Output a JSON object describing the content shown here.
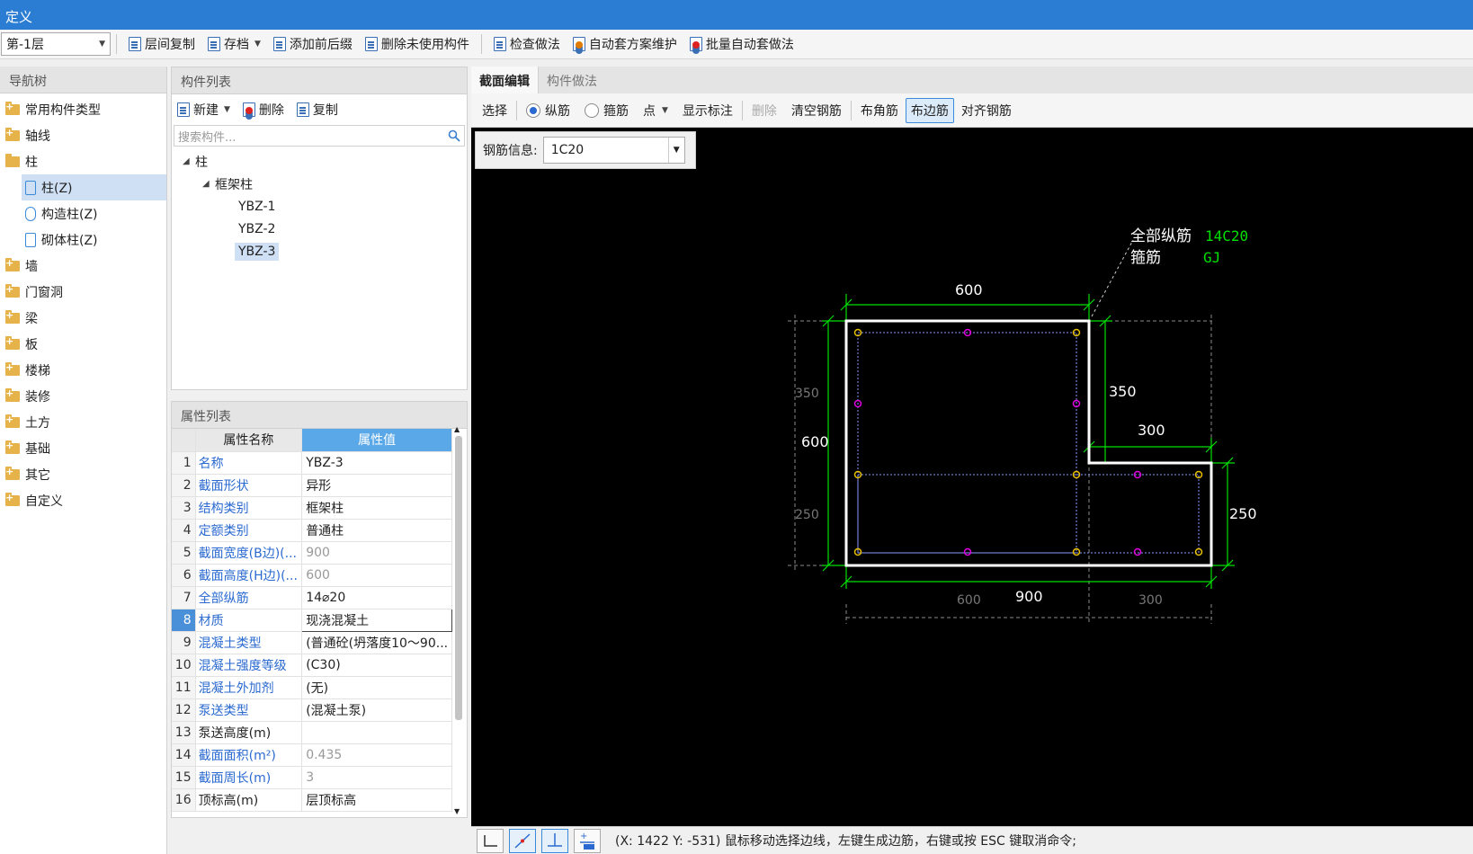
{
  "window": {
    "title": "定义"
  },
  "toolbar": {
    "floor": "第-1层",
    "buttons": [
      "层间复制",
      "存档",
      "添加前后缀",
      "删除未使用构件",
      "检查做法",
      "自动套方案维护",
      "批量自动套做法"
    ]
  },
  "nav": {
    "title": "导航树",
    "items": [
      {
        "label": "常用构件类型",
        "level": 0,
        "icon": "folder-icon"
      },
      {
        "label": "轴线",
        "level": 0,
        "icon": "folder-icon"
      },
      {
        "label": "柱",
        "level": 0,
        "icon": "folder-open-icon"
      },
      {
        "label": "柱(Z)",
        "level": 1,
        "icon": "column-icon",
        "selected": true
      },
      {
        "label": "构造柱(Z)",
        "level": 1,
        "icon": "constructional-column-icon"
      },
      {
        "label": "砌体柱(Z)",
        "level": 1,
        "icon": "masonry-column-icon"
      },
      {
        "label": "墙",
        "level": 0,
        "icon": "folder-icon"
      },
      {
        "label": "门窗洞",
        "level": 0,
        "icon": "folder-icon"
      },
      {
        "label": "梁",
        "level": 0,
        "icon": "folder-icon"
      },
      {
        "label": "板",
        "level": 0,
        "icon": "folder-icon"
      },
      {
        "label": "楼梯",
        "level": 0,
        "icon": "folder-icon"
      },
      {
        "label": "装修",
        "level": 0,
        "icon": "folder-icon"
      },
      {
        "label": "土方",
        "level": 0,
        "icon": "folder-icon"
      },
      {
        "label": "基础",
        "level": 0,
        "icon": "folder-icon"
      },
      {
        "label": "其它",
        "level": 0,
        "icon": "folder-icon"
      },
      {
        "label": "自定义",
        "level": 0,
        "icon": "folder-icon"
      }
    ]
  },
  "components": {
    "title": "构件列表",
    "new_label": "新建",
    "delete_label": "删除",
    "copy_label": "复制",
    "search_placeholder": "搜索构件...",
    "tree": [
      {
        "label": "柱",
        "level": 0,
        "expanded": true
      },
      {
        "label": "框架柱",
        "level": 1,
        "expanded": true
      },
      {
        "label": "YBZ-1",
        "level": 2
      },
      {
        "label": "YBZ-2",
        "level": 2
      },
      {
        "label": "YBZ-3",
        "level": 2,
        "selected": true
      }
    ]
  },
  "properties": {
    "title": "属性列表",
    "col_name": "属性名称",
    "col_value": "属性值",
    "rows": [
      {
        "n": "1",
        "name": "名称",
        "value": "YBZ-3"
      },
      {
        "n": "2",
        "name": "截面形状",
        "value": "异形"
      },
      {
        "n": "3",
        "name": "结构类别",
        "value": "框架柱"
      },
      {
        "n": "4",
        "name": "定额类别",
        "value": "普通柱"
      },
      {
        "n": "5",
        "name": "截面宽度(B边)(...",
        "value": "900",
        "grey": true
      },
      {
        "n": "6",
        "name": "截面高度(H边)(...",
        "value": "600",
        "grey": true
      },
      {
        "n": "7",
        "name": "全部纵筋",
        "value": "14⌀20"
      },
      {
        "n": "8",
        "name": "材质",
        "value": "现浇混凝土",
        "editing": true
      },
      {
        "n": "9",
        "name": "混凝土类型",
        "value": "(普通砼(坍落度10～90..."
      },
      {
        "n": "10",
        "name": "混凝土强度等级",
        "value": "(C30)"
      },
      {
        "n": "11",
        "name": "混凝土外加剂",
        "value": "(无)"
      },
      {
        "n": "12",
        "name": "泵送类型",
        "value": "(混凝土泵)"
      },
      {
        "n": "13",
        "name": "泵送高度(m)",
        "value": "",
        "plain": true
      },
      {
        "n": "14",
        "name": "截面面积(m²)",
        "value": "0.435",
        "grey": true
      },
      {
        "n": "15",
        "name": "截面周长(m)",
        "value": "3",
        "grey": true
      },
      {
        "n": "16",
        "name": "顶标高(m)",
        "value": "层顶标高",
        "plain": true
      }
    ]
  },
  "editor": {
    "tabs": [
      "截面编辑",
      "构件做法"
    ],
    "toolbar": {
      "select": "选择",
      "longitudinal": "纵筋",
      "stirrup": "箍筋",
      "point": "点",
      "show_dims": "显示标注",
      "delete": "删除",
      "clear": "清空钢筋",
      "corner": "布角筋",
      "edge": "布边筋",
      "align": "对齐钢筋"
    },
    "rebar_info_label": "钢筋信息:",
    "rebar_info_value": "1C20",
    "drawing": {
      "label_all_rebar": "全部纵筋",
      "value_all_rebar": "14C20",
      "label_stirrup": "箍筋",
      "value_stirrup": "GJ",
      "dims": {
        "top": "600",
        "right_upper": "350",
        "step_width": "300",
        "right_lower": "250",
        "left_total": "600",
        "bottom_total": "900",
        "left_upper_ghost": "350",
        "left_lower_ghost": "250",
        "bottom_left_ghost": "600",
        "bottom_right_ghost": "300"
      },
      "colors": {
        "outline": "#ffffff",
        "dimension": "#00ff00",
        "corner_rebar": "#e8c000",
        "edge_rebar": "#e000e0",
        "guide": "#8899ff"
      }
    },
    "status": "(X: 1422 Y: -531) 鼠标移动选择边线，左键生成边筋，右键或按 ESC 键取消命令;"
  }
}
